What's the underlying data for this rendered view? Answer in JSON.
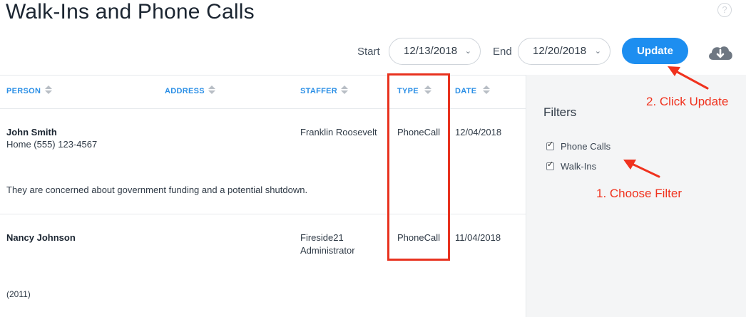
{
  "header": {
    "title": "Walk-Ins and Phone Calls",
    "help_glyph": "?"
  },
  "toolbar": {
    "start_label": "Start",
    "start_value": "12/13/2018",
    "end_label": "End",
    "end_value": "12/20/2018",
    "update_label": "Update"
  },
  "table": {
    "columns": [
      "PERSON",
      "ADDRESS",
      "STAFFER",
      "TYPE",
      "DATE"
    ],
    "rows": [
      {
        "person": "John Smith",
        "person_sub": "Home (555) 123-4567",
        "address": "",
        "staffer_line1": "Franklin Roosevelt",
        "staffer_line2": "",
        "type": "PhoneCall",
        "date": "12/04/2018",
        "note": "They are concerned about government funding and a potential shutdown."
      },
      {
        "person": "Nancy Johnson",
        "person_sub": "",
        "address": "",
        "staffer_line1": "Fireside21",
        "staffer_line2": "Administrator",
        "type": "PhoneCall",
        "date": "11/04/2018",
        "note": "(2011)"
      }
    ]
  },
  "sidebar": {
    "title": "Filters",
    "filters": [
      {
        "label": "Phone Calls",
        "checked": true
      },
      {
        "label": "Walk-Ins",
        "checked": true
      }
    ]
  },
  "annotations": {
    "step2": "2. Click Update",
    "step1": "1. Choose Filter",
    "color": "#f0321e"
  },
  "colors": {
    "accent": "#1d8ef0",
    "header_link": "#2b8fe6",
    "sidebar_bg": "#f4f5f6"
  }
}
